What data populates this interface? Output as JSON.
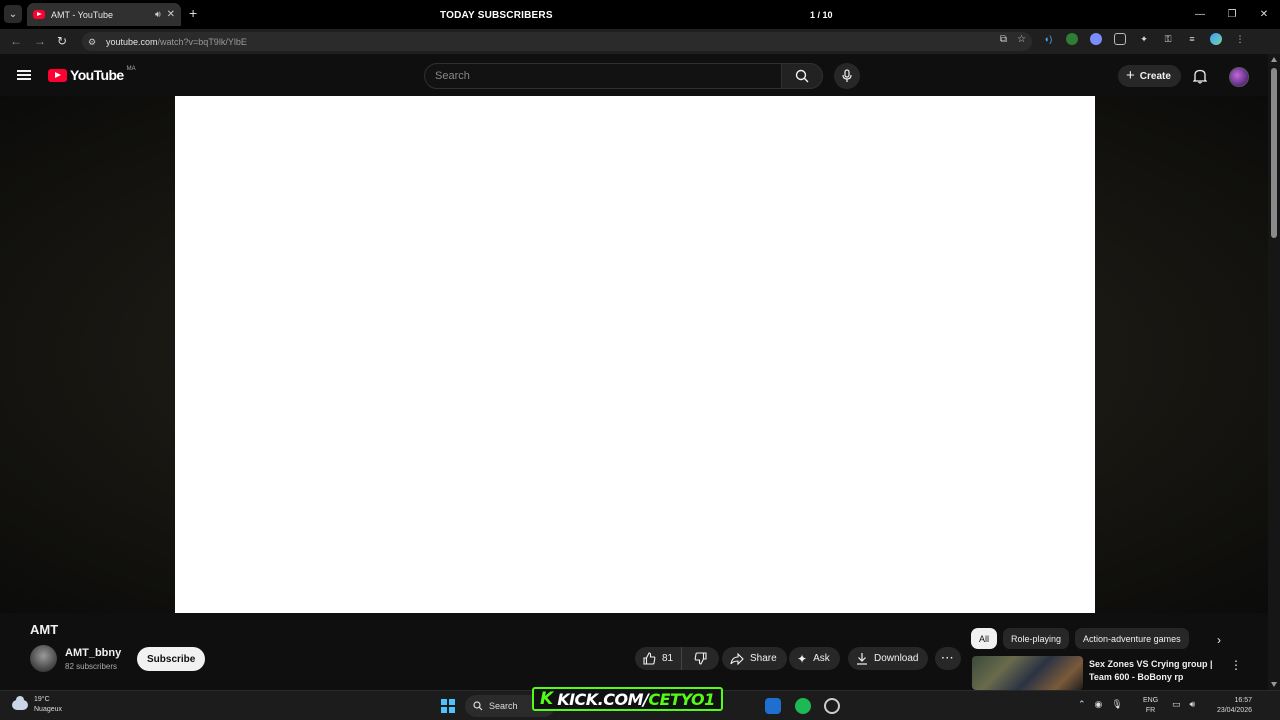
{
  "browser": {
    "tab_title": "AMT - YouTube",
    "url_host": "youtube.com",
    "url_path": "/watch?v=bqT9lk/YlbE"
  },
  "overlay": {
    "title": "TODAY SUBSCRIBERS",
    "count": "1 / 10",
    "progress": 0.1
  },
  "youtube": {
    "logo_text": "YouTube",
    "country_code": "MA",
    "search_placeholder": "Search",
    "create_label": "Create"
  },
  "video": {
    "title": "AMT",
    "channel_name": "AMT_bbny",
    "subscribers": "82 subscribers",
    "subscribe_label": "Subscribe",
    "likes": "81",
    "share_label": "Share",
    "ask_label": "Ask",
    "download_label": "Download"
  },
  "chips": [
    {
      "label": "All",
      "active": true
    },
    {
      "label": "Role-playing",
      "active": false
    },
    {
      "label": "Action-adventure games",
      "active": false
    }
  ],
  "recommendation": {
    "title": "Sex Zones VS Crying group | Team 600 - BoBony rp"
  },
  "taskbar": {
    "temperature": "19°C",
    "weather": "Nuageux",
    "search_label": "Search",
    "kick_prefix": "KICK.COM/",
    "kick_channel": "CETYO1",
    "lang_primary": "ENG",
    "lang_secondary": "FR",
    "time": "16:57",
    "date": "23/04/2026"
  },
  "colors": {
    "yt_red": "#ff0033",
    "kick_green": "#53fc18",
    "overlay_border": "#8a1fa8"
  }
}
